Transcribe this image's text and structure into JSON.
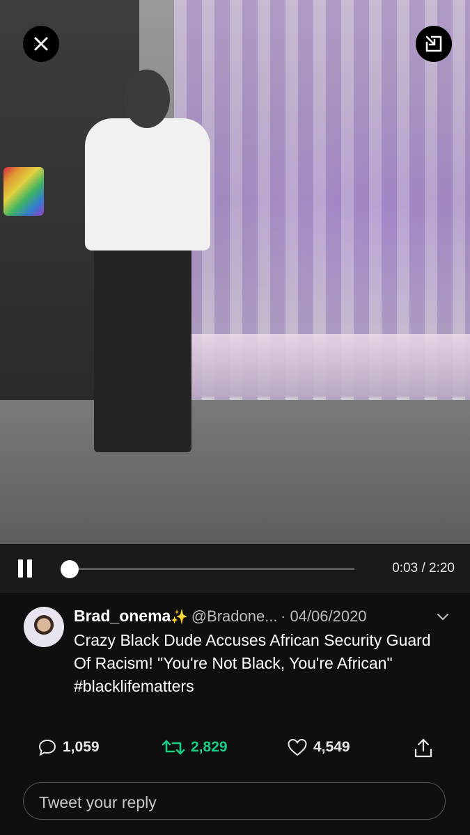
{
  "player": {
    "close_icon": "close-icon",
    "minimize_icon": "minimize-to-corner-icon",
    "pause_icon": "pause-icon",
    "progress_fraction": 0.021,
    "current_time": "0:03",
    "duration": "2:20",
    "time_separator": "/"
  },
  "tweet": {
    "display_name": "Brad_onema",
    "name_emoji": "✨",
    "handle": "@Bradone...",
    "date": "· 04/06/2020",
    "text": "Crazy Black Dude Accuses African Security Guard Of Racism! \"You're Not Black, You're African\" #blacklifematters",
    "menu_icon": "chevron-down-icon"
  },
  "actions": {
    "replies": "1,059",
    "retweets": "2,829",
    "likes": "4,549",
    "retweet_color": "#19cf86"
  },
  "reply": {
    "placeholder": "Tweet your reply"
  }
}
